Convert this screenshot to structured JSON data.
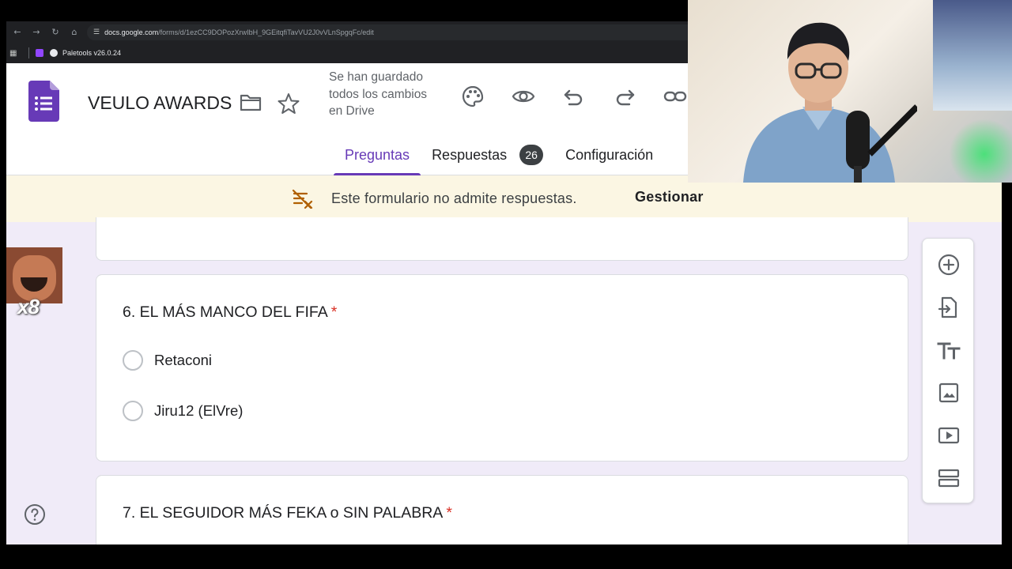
{
  "browser": {
    "url_host": "docs.google.com",
    "url_path": "/forms/d/1ezCC9DOPozXrwIbH_9GEitqfiTavVU2J0vVLnSpgqFc/edit",
    "bookmark_label": "Paletools v26.0.24"
  },
  "header": {
    "title": "VEULO AWARDS",
    "saved_status": "Se han guardado todos los cambios en Drive",
    "tabs": [
      {
        "label": "Preguntas",
        "active": true
      },
      {
        "label": "Respuestas",
        "badge": "26"
      },
      {
        "label": "Configuración"
      }
    ]
  },
  "banner": {
    "message": "Este formulario no admite respuestas.",
    "action": "Gestionar"
  },
  "questions": [
    {
      "title": "6. EL MÁS MANCO DEL FIFA",
      "required_mark": "*",
      "options": [
        "Retaconi",
        "Jiru12 (ElVre)"
      ]
    },
    {
      "title": "7. EL SEGUIDOR MÁS FEKA o SIN PALABRA",
      "required_mark": "*"
    }
  ],
  "sticker_label": "x8",
  "colors": {
    "accent": "#673ab7",
    "required": "#d93025",
    "banner_bg": "#fbf6e3",
    "canvas_bg": "#f0ebf8"
  }
}
